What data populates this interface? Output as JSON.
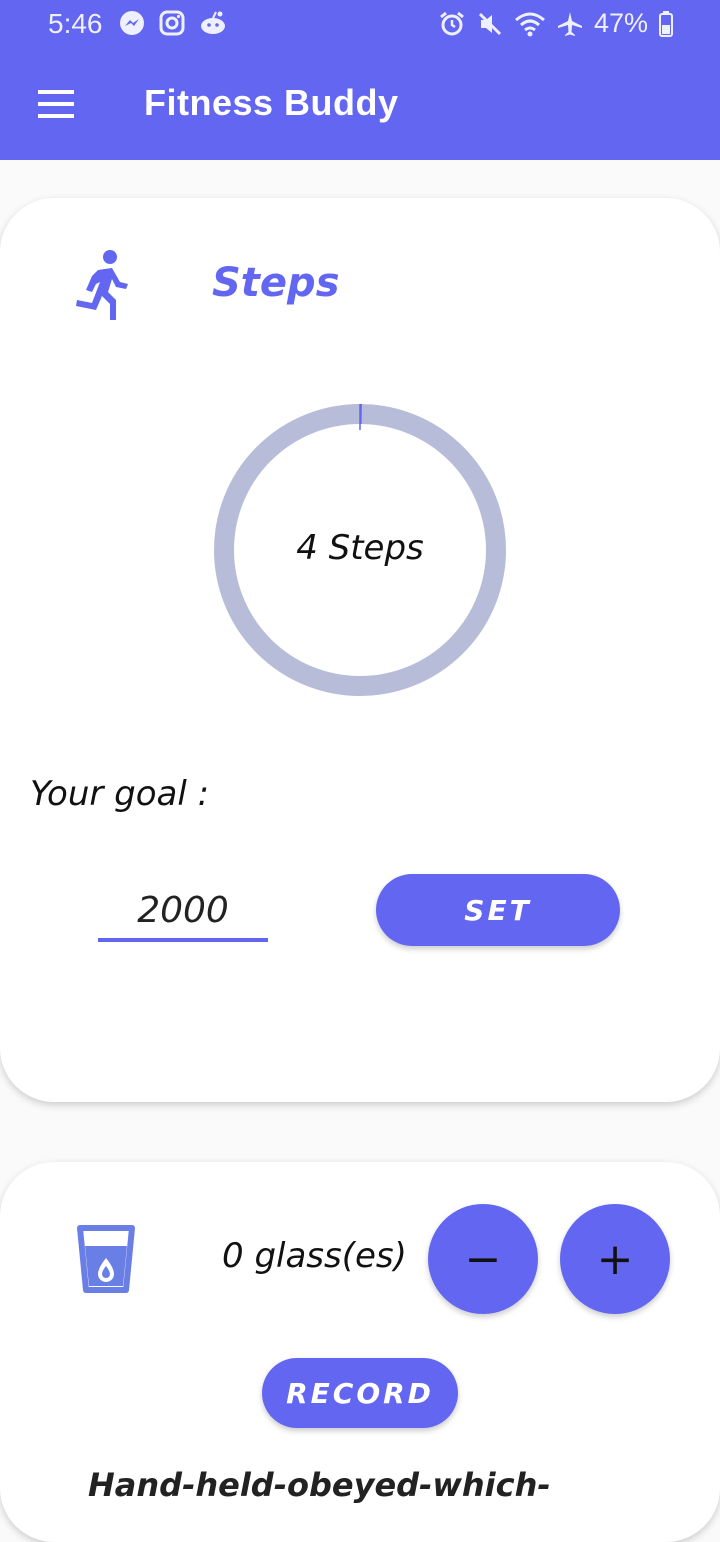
{
  "status_bar": {
    "time": "5:46",
    "battery": "47%",
    "left_icons": [
      "messenger-icon",
      "instagram-icon",
      "reddit-icon"
    ],
    "right_icons": [
      "alarm-icon",
      "mute-icon",
      "wifi-icon",
      "airplane-icon",
      "battery-icon"
    ]
  },
  "app_bar": {
    "title": "Fitness Buddy",
    "menu_icon": "menu-icon"
  },
  "steps_card": {
    "title": "Steps",
    "icon": "running-icon",
    "ring_label": "4 Steps",
    "progress_fraction": 0.002,
    "goal_label": "Your goal :",
    "goal_value": "2000",
    "set_button": "SET"
  },
  "water_card": {
    "icon": "glass-water-icon",
    "count_label": "0 glass(es)",
    "minus_button": "−",
    "plus_button": "+",
    "record_button": "RECORD",
    "cut_off_text": "Hand-held-obeyed-which-"
  },
  "colors": {
    "primary": "#6366f1",
    "ring_track": "#b7bcd8",
    "card": "#ffffff"
  }
}
